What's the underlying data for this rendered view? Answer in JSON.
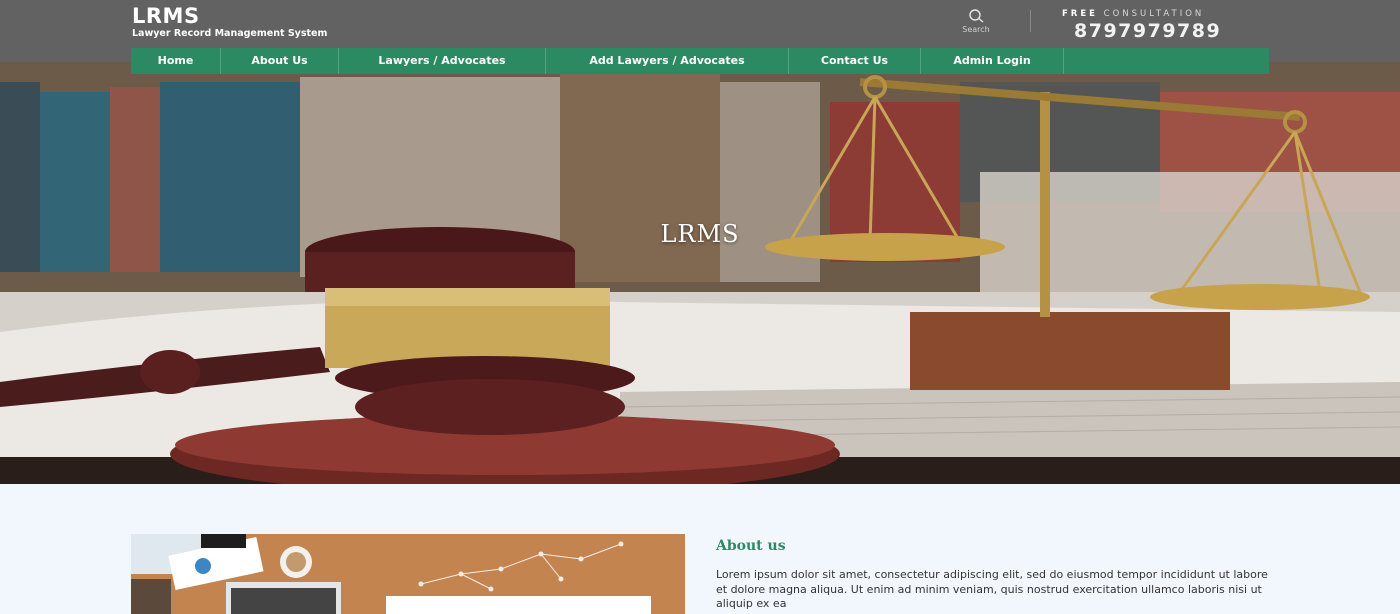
{
  "brand": {
    "title": "LRMS",
    "subtitle": "Lawyer Record Management System"
  },
  "search": {
    "label": "Search",
    "icon": "search-icon"
  },
  "consultation": {
    "free": "FREE",
    "rest": "CONSULTATION",
    "phone": "8797979789"
  },
  "nav": {
    "items": [
      {
        "label": "Home"
      },
      {
        "label": "About Us"
      },
      {
        "label": "Lawyers / Advocates"
      },
      {
        "label": "Add Lawyers / Advocates"
      },
      {
        "label": "Contact Us"
      },
      {
        "label": "Admin Login"
      }
    ]
  },
  "hero": {
    "title": "LRMS"
  },
  "about": {
    "title": "About us",
    "text": "Lorem ipsum dolor sit amet, consectetur adipiscing elit, sed do eiusmod tempor incididunt ut labore et dolore magna aliqua. Ut enim ad minim veniam, quis nostrud exercitation ullamco laboris nisi ut aliquip ex ea"
  },
  "colors": {
    "header_bg": "#626262",
    "nav_bg": "#2b8a61",
    "accent": "#2b8a61",
    "page_bg": "#f2f7fd"
  }
}
